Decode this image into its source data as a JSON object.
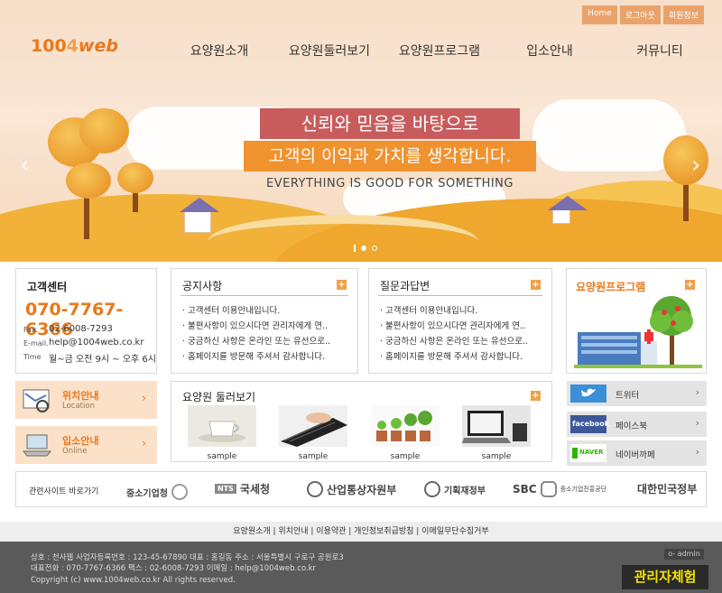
{
  "header": {
    "top_links": [
      "Home",
      "로그아웃",
      "회원정보"
    ],
    "logo_prefix": "100",
    "logo_num": "4",
    "logo_suffix": "web",
    "gnb": [
      "요양원소개",
      "요양원둘러보기",
      "요양원프로그램",
      "입소안내",
      "커뮤니티"
    ]
  },
  "hero": {
    "slogan_line1": "신뢰와 믿음을 바탕으로",
    "slogan_line2": "고객의 이익과 가치를 생각합니다.",
    "slogan_line3": "EVERYTHING IS GOOD FOR SOMETHING",
    "prev_arrow": "‹",
    "next_arrow": "›",
    "slides": 3,
    "active_slide": 2
  },
  "customer_center": {
    "title": "고객센터",
    "phone": "070-7767-6366",
    "fax_label": "Fax.",
    "fax": "02-6008-7293",
    "email_label": "E-mail.",
    "email": "help@1004web.co.kr",
    "time_label": "Time",
    "time": "월~금 오전 9시 ~ 오후 6시"
  },
  "notice": {
    "title": "공지사항",
    "items": [
      "· 고객센터 이용안내입니다.",
      "· 불편사항이 있으시다면 관리자에게 연..",
      "· 궁금하신 사항은 온라인 또는 유선으로..",
      "· 홈페이지를 방문해 주셔서 감사합니다."
    ]
  },
  "qna": {
    "title": "질문과답변",
    "items": [
      "· 고객센터 이용안내입니다.",
      "· 불편사항이 있으시다면 관리자에게 연..",
      "· 궁금하신 사항은 온라인 또는 유선으로..",
      "· 홈페이지를 방문해 주셔서 감사합니다."
    ]
  },
  "program": {
    "title": "요양원프로그램"
  },
  "quick_links": [
    {
      "title": "위치안내",
      "sub": "Location"
    },
    {
      "title": "입소안내",
      "sub": "Online"
    }
  ],
  "gallery": {
    "title": "요양원 둘러보기",
    "items": [
      "sample",
      "sample",
      "sample",
      "sample"
    ]
  },
  "sns": [
    {
      "logo": "twitter",
      "label": "트위터"
    },
    {
      "logo": "facebook",
      "label": "페이스북"
    },
    {
      "logo": "NAVER",
      "label": "네이버까페"
    }
  ],
  "related": {
    "label": "관련사이트 바로가기",
    "sites": [
      "중소기업청",
      "국세청",
      "산업통상자원부",
      "기획재정부",
      "SBC",
      "중소기업진흥공단",
      "대한민국정부"
    ]
  },
  "footer_nav": "요양원소개 | 위치안내 | 이용약관 | 개인정보취급방침 | 이메일무단수집거부",
  "footer": {
    "line1": "상호 : 천사웹   사업자등록번호 : 123-45-67890  대표 : 홍길동  주소 : 서울특별시 구로구 공원로3",
    "line2": "대표전화 : 070-7767-6366  팩스 : 02-6008-7293  이메일 : help@1004web.co.kr",
    "line3": "Copyright (c) www.1004web.co.kr All rights reserved.",
    "admin": "o- admin",
    "experience": "관리자체험"
  },
  "colors": {
    "accent": "#e9781c",
    "notice_bar": "#c85c5c",
    "slogan_orange": "#f0922e",
    "footer_bg": "#5a5a5a"
  }
}
